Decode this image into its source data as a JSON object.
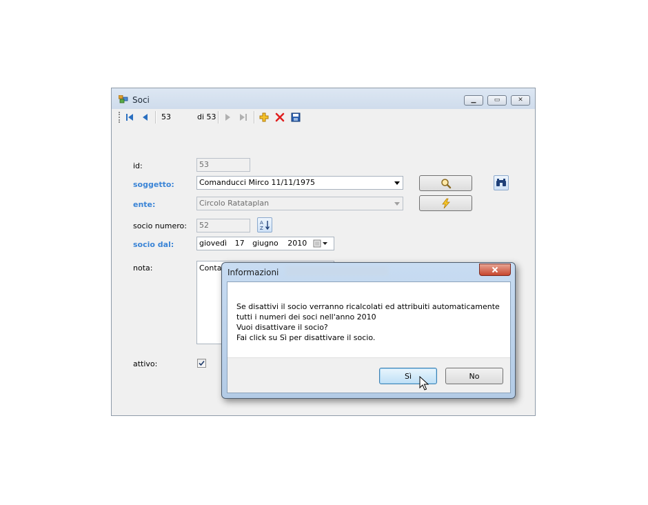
{
  "window": {
    "title": "Soci",
    "controls": [
      "minimize-icon",
      "maximize-icon",
      "close-icon"
    ]
  },
  "toolbar": {
    "position_value": "53",
    "count_label": "di 53",
    "icons": [
      "move-first-icon",
      "move-previous-icon",
      "move-next-icon",
      "move-last-icon",
      "add-icon",
      "delete-icon",
      "save-icon"
    ]
  },
  "form": {
    "id_label": "id:",
    "id_value": "53",
    "soggetto_label": "soggetto:",
    "soggetto_value": "Comanducci Mirco 11/11/1975",
    "ente_label": "ente:",
    "ente_value": "Circolo Ratataplan",
    "socio_numero_label": "socio numero:",
    "socio_numero_value": "52",
    "socio_dal_label": "socio dal:",
    "socio_dal_day": "giovedì",
    "socio_dal_date": "17",
    "socio_dal_month": "giugno",
    "socio_dal_year": "2010",
    "nota_label": "nota:",
    "nota_value": "Contatt",
    "attivo_label": "attivo:",
    "attivo_checked": true
  },
  "dialog": {
    "title": "Informazioni",
    "message_lines": [
      "Se disattivi il socio verranno ricalcolati ed attribuiti automaticamente",
      "tutti i numeri dei soci nell'anno 2010",
      "Vuoi disattivare il socio?",
      "Fai click su Sì per disattivare il socio."
    ],
    "yes_label": "Sì",
    "no_label": "No"
  },
  "colors": {
    "required_label": "#3a84d6",
    "title_bar": "#dde7f3",
    "dialog_frame": "#c8dcf2"
  }
}
